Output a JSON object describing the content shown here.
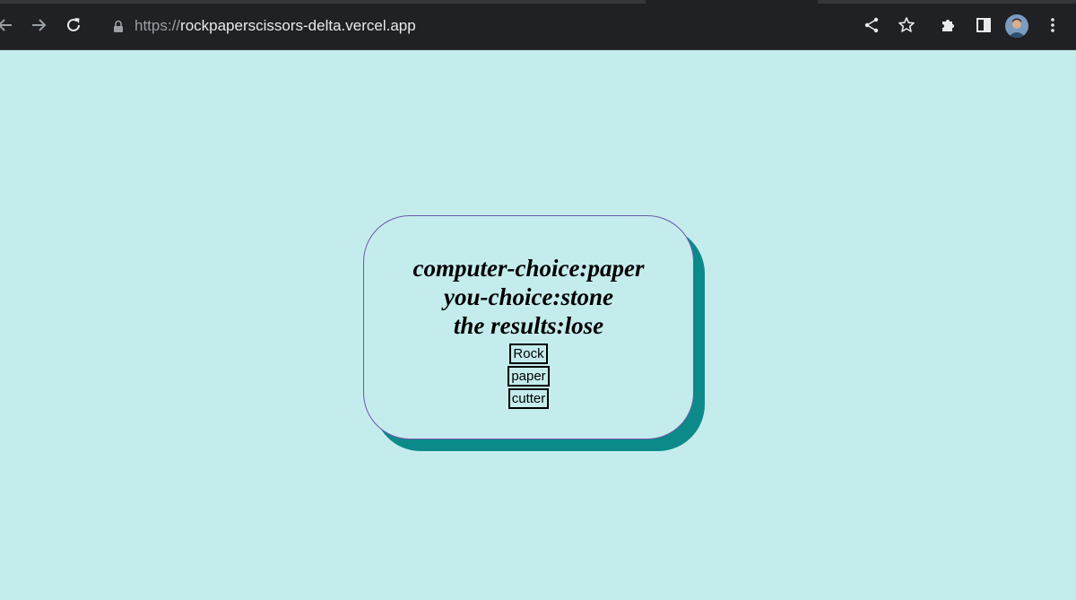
{
  "browser": {
    "url_scheme": "https://",
    "url_host": "rockpaperscissors-delta.vercel.app",
    "icons": [
      "back-arrow-icon",
      "forward-arrow-icon",
      "reload-icon",
      "lock-icon",
      "share-icon",
      "bookmark-star-icon",
      "extensions-puzzle-icon",
      "side-panel-icon",
      "profile-avatar",
      "kebab-menu-icon"
    ]
  },
  "game": {
    "computer_choice": "computer-choice:paper",
    "you_choice": "you-choice:stone",
    "result": "the results:lose",
    "buttons": {
      "rock": "Rock",
      "paper": "paper",
      "cutter": "cutter"
    }
  },
  "colors": {
    "page_background": "#c5eced",
    "card_shadow": "#0c8a8a",
    "card_border": "#6a5aa8"
  }
}
